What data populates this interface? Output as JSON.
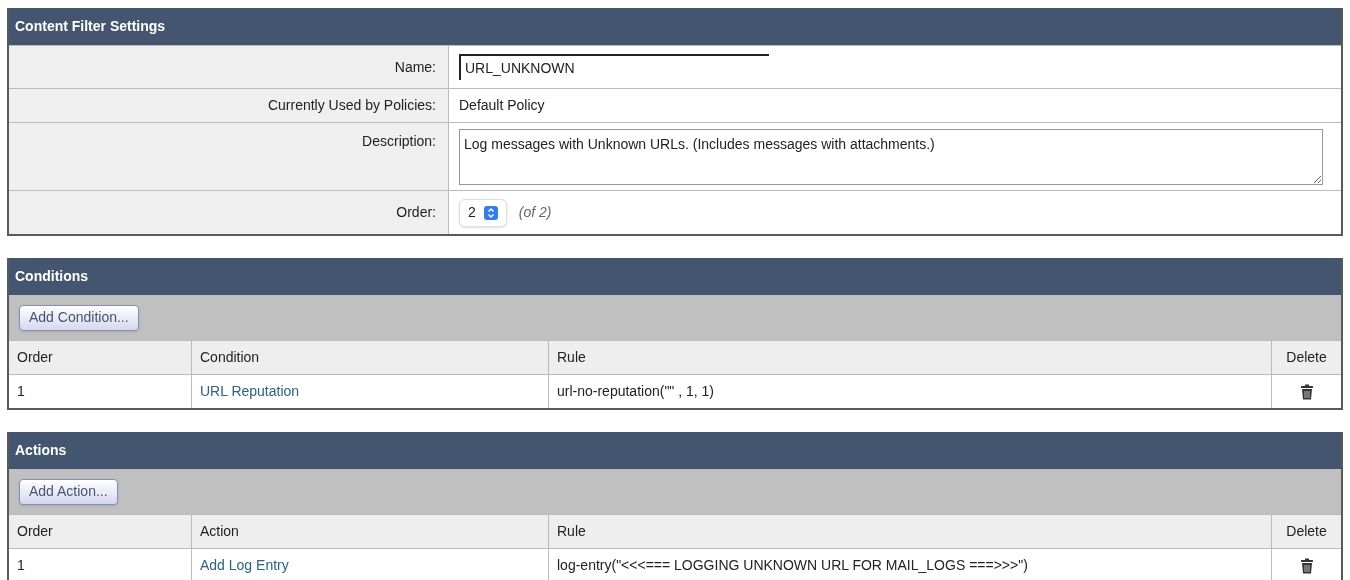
{
  "settings": {
    "title": "Content Filter Settings",
    "fields": [
      {
        "kind": "text",
        "label": "Name:",
        "value": "URL_UNKNOWN"
      },
      {
        "kind": "plain",
        "label": "Currently Used by Policies:",
        "value": "Default Policy"
      },
      {
        "kind": "textarea",
        "label": "Description:",
        "value": "Log messages with Unknown URLs. (Includes messages with attachments.)"
      },
      {
        "kind": "select",
        "label": "Order:",
        "value": "2",
        "note": "(of 2)"
      }
    ]
  },
  "sections": [
    {
      "title": "Conditions",
      "add_button": "Add Condition...",
      "columns": [
        "Order",
        "Condition",
        "Rule",
        "Delete"
      ],
      "rows": [
        {
          "order": "1",
          "name": "URL Reputation",
          "rule": "url-no-reputation(\"\" , 1, 1)"
        }
      ]
    },
    {
      "title": "Actions",
      "add_button": "Add Action...",
      "columns": [
        "Order",
        "Action",
        "Rule",
        "Delete"
      ],
      "rows": [
        {
          "order": "1",
          "name": "Add Log Entry",
          "rule": "log-entry(\"<<<=== LOGGING UNKNOWN URL FOR MAIL_LOGS ===>>>\")"
        }
      ]
    }
  ]
}
